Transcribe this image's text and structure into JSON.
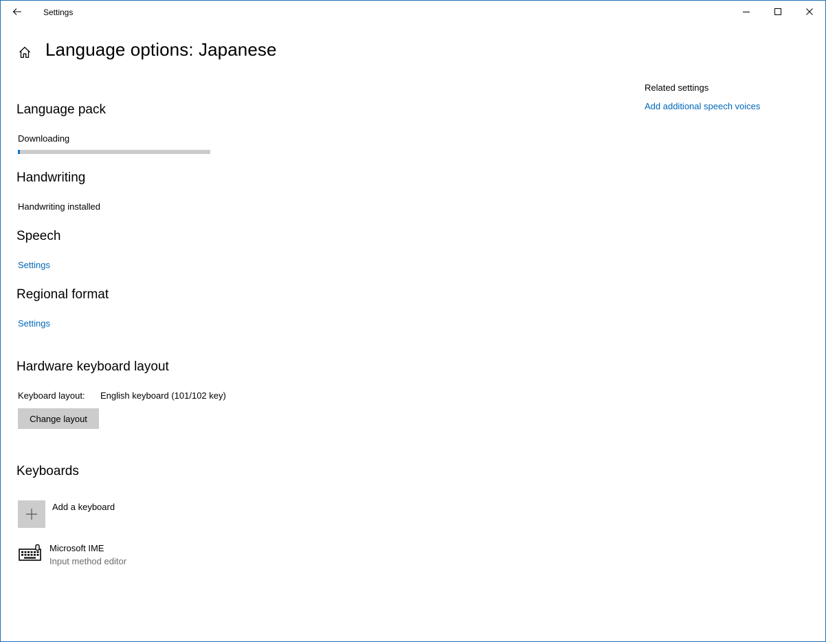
{
  "window": {
    "title": "Settings"
  },
  "header": {
    "title": "Language options: Japanese"
  },
  "language_pack": {
    "title": "Language pack",
    "status": "Downloading",
    "progress_percent": 1
  },
  "handwriting": {
    "title": "Handwriting",
    "status": "Handwriting installed"
  },
  "speech": {
    "title": "Speech",
    "settings_link": "Settings"
  },
  "regional_format": {
    "title": "Regional format",
    "settings_link": "Settings"
  },
  "hardware_keyboard": {
    "title": "Hardware keyboard layout",
    "layout_label": "Keyboard layout:",
    "layout_value": "English keyboard (101/102 key)",
    "change_button": "Change layout"
  },
  "keyboards": {
    "title": "Keyboards",
    "add_label": "Add a keyboard",
    "items": [
      {
        "name": "Microsoft IME",
        "description": "Input method editor",
        "icon": "keyboard-icon"
      }
    ]
  },
  "related": {
    "title": "Related settings",
    "link": "Add additional speech voices"
  },
  "colors": {
    "accent": "#0078d7",
    "link": "#0067b8",
    "button_bg": "#cccccc"
  }
}
